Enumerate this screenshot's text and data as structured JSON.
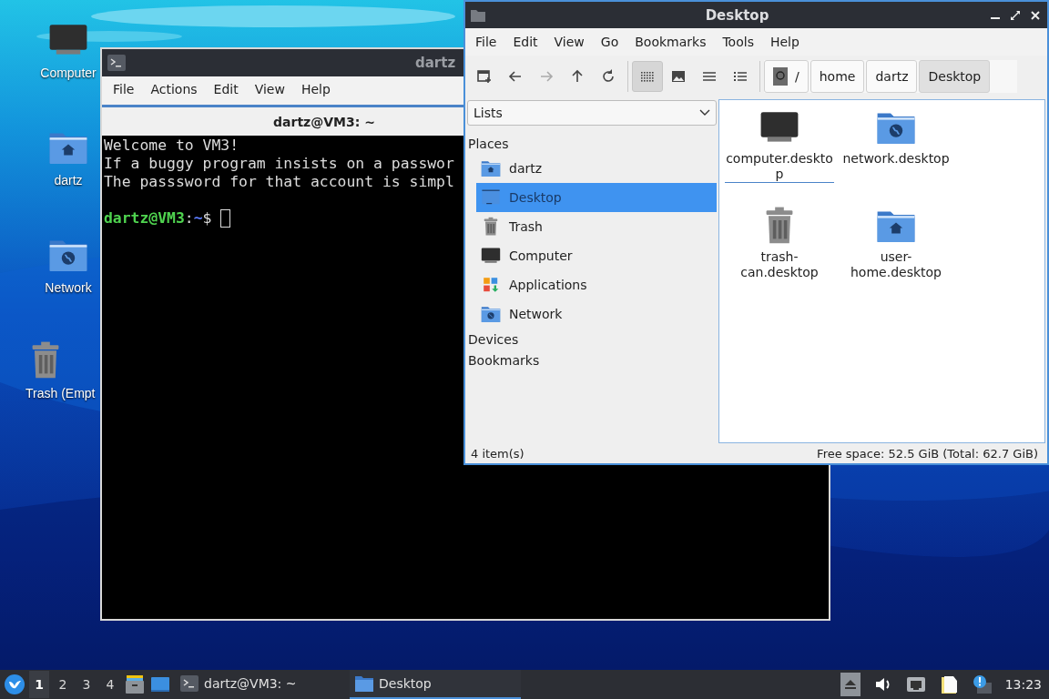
{
  "desktop_icons": [
    {
      "label": "Computer",
      "kind": "computer"
    },
    {
      "label": "dartz",
      "kind": "home"
    },
    {
      "label": "Network",
      "kind": "network"
    },
    {
      "label": "Trash (Empt",
      "kind": "trash"
    }
  ],
  "terminal": {
    "title": "dartz",
    "menu": [
      "File",
      "Actions",
      "Edit",
      "View",
      "Help"
    ],
    "tab": {
      "label": "dartz@VM3: ~",
      "selected": true
    },
    "lines": [
      "Welcome to VM3!",
      "If a buggy program insists on a passwor",
      "The passsword for that account is simpl"
    ],
    "prompt": [
      {
        "text": "dartz@VM3",
        "kind": "user"
      },
      {
        "text": ":",
        "kind": "plain"
      },
      {
        "text": "~",
        "kind": "path"
      },
      {
        "text": "$",
        "kind": "plain"
      }
    ]
  },
  "file_manager": {
    "title": "Desktop",
    "menu": [
      "File",
      "Edit",
      "View",
      "Go",
      "Bookmarks",
      "Tools",
      "Help"
    ],
    "nav_buttons": [
      {
        "kind": "new-tab",
        "disabled": false
      },
      {
        "kind": "back",
        "disabled": false
      },
      {
        "kind": "forward",
        "disabled": true
      },
      {
        "kind": "up",
        "disabled": false
      },
      {
        "kind": "reload",
        "disabled": false
      }
    ],
    "view_modes": [
      {
        "kind": "icons",
        "selected": true
      },
      {
        "kind": "thumbnails",
        "selected": false
      },
      {
        "kind": "compact",
        "selected": false
      },
      {
        "kind": "detailed",
        "selected": false
      }
    ],
    "path": [
      {
        "label": "/",
        "kind": "root",
        "selected": false
      },
      {
        "label": "home",
        "kind": "dir",
        "selected": false
      },
      {
        "label": "dartz",
        "kind": "dir",
        "selected": false
      },
      {
        "label": "Desktop",
        "kind": "dir",
        "selected": true
      }
    ],
    "side_pane": {
      "mode": "Lists",
      "sections": [
        {
          "label": "Places",
          "items": [
            {
              "label": "dartz",
              "kind": "home",
              "selected": false
            },
            {
              "label": "Desktop",
              "kind": "desktop",
              "selected": true
            },
            {
              "label": "Trash",
              "kind": "trash",
              "selected": false
            },
            {
              "label": "Computer",
              "kind": "computer",
              "selected": false
            },
            {
              "label": "Applications",
              "kind": "apps",
              "selected": false
            },
            {
              "label": "Network",
              "kind": "network",
              "selected": false
            }
          ]
        },
        {
          "label": "Devices"
        },
        {
          "label": "Bookmarks"
        }
      ]
    },
    "files": [
      {
        "name": "computer.desktop",
        "kind": "computer",
        "focused": true
      },
      {
        "name": "network.desktop",
        "kind": "network",
        "focused": false
      },
      {
        "name": "trash-can.desktop",
        "kind": "trash",
        "focused": false
      },
      {
        "name": "user-home.desktop",
        "kind": "home",
        "focused": false
      }
    ],
    "status": {
      "count": "4 item(s)",
      "free_space": "Free space: 52.5 GiB (Total: 62.7 GiB)"
    }
  },
  "taskbar": {
    "workspaces": [
      {
        "label": "1",
        "selected": true
      },
      {
        "label": "2",
        "selected": false
      },
      {
        "label": "3",
        "selected": false
      },
      {
        "label": "4",
        "selected": false
      }
    ],
    "launchers": [
      {
        "kind": "file-manager"
      },
      {
        "kind": "show-desktop"
      }
    ],
    "tasks": [
      {
        "label": "dartz@VM3: ~",
        "kind": "terminal",
        "selected": false
      },
      {
        "label": "Desktop",
        "kind": "folder",
        "selected": true
      }
    ],
    "tray": [
      {
        "kind": "eject"
      },
      {
        "kind": "volume"
      },
      {
        "kind": "network"
      },
      {
        "kind": "clipboard"
      },
      {
        "kind": "notification"
      }
    ],
    "clock": "13:23"
  }
}
